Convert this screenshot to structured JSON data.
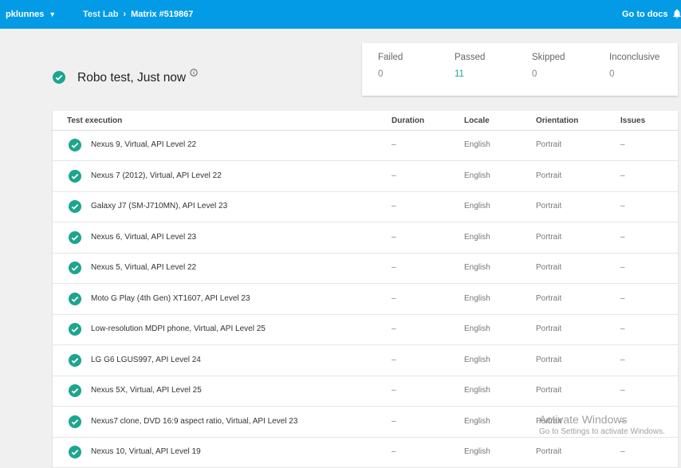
{
  "header": {
    "project": "pklunnes",
    "breadcrumb": [
      "Test Lab",
      "Matrix #519867"
    ],
    "docs_link": "Go to docs",
    "icons": [
      "chevron-down-icon",
      "bell-icon"
    ],
    "bar_color": "#039be5"
  },
  "summary": {
    "title": "Robo test, Just now",
    "status_icon": "check-circle-icon",
    "info_icon": "info-icon"
  },
  "stats": [
    {
      "label": "Failed",
      "value": "0"
    },
    {
      "label": "Passed",
      "value": "11"
    },
    {
      "label": "Skipped",
      "value": "0"
    },
    {
      "label": "Inconclusive",
      "value": "0"
    }
  ],
  "table": {
    "headers": [
      "Test execution",
      "Duration",
      "Locale",
      "Orientation",
      "Issues"
    ],
    "rows": [
      {
        "name": "Nexus 9, Virtual, API Level 22",
        "duration": "–",
        "locale": "English",
        "orientation": "Portrait",
        "issues": "–"
      },
      {
        "name": "Nexus 7 (2012), Virtual, API Level 22",
        "duration": "–",
        "locale": "English",
        "orientation": "Portrait",
        "issues": "–"
      },
      {
        "name": "Galaxy J7 (SM-J710MN), API Level 23",
        "duration": "–",
        "locale": "English",
        "orientation": "Portrait",
        "issues": "–"
      },
      {
        "name": "Nexus 6, Virtual, API Level 23",
        "duration": "–",
        "locale": "English",
        "orientation": "Portrait",
        "issues": "–"
      },
      {
        "name": "Nexus 5, Virtual, API Level 22",
        "duration": "–",
        "locale": "English",
        "orientation": "Portrait",
        "issues": "–"
      },
      {
        "name": "Moto G Play (4th Gen) XT1607, API Level 23",
        "duration": "–",
        "locale": "English",
        "orientation": "Portrait",
        "issues": "–"
      },
      {
        "name": "Low-resolution MDPI phone, Virtual, API Level 25",
        "duration": "–",
        "locale": "English",
        "orientation": "Portrait",
        "issues": "–"
      },
      {
        "name": "LG G6 LGUS997, API Level 24",
        "duration": "–",
        "locale": "English",
        "orientation": "Portrait",
        "issues": "–"
      },
      {
        "name": "Nexus 5X, Virtual, API Level 25",
        "duration": "–",
        "locale": "English",
        "orientation": "Portrait",
        "issues": "–"
      },
      {
        "name": "Nexus7 clone, DVD 16:9 aspect ratio, Virtual, API Level 23",
        "duration": "–",
        "locale": "English",
        "orientation": "Portrait",
        "issues": "–"
      },
      {
        "name": "Nexus 10, Virtual, API Level 19",
        "duration": "–",
        "locale": "English",
        "orientation": "Portrait",
        "issues": "–"
      }
    ]
  },
  "watermark": {
    "title": "Activate Windows",
    "subtitle": "Go to Settings to activate Windows."
  },
  "colors": {
    "pass_green": "#1da58e",
    "check_green": "#1da58e"
  }
}
